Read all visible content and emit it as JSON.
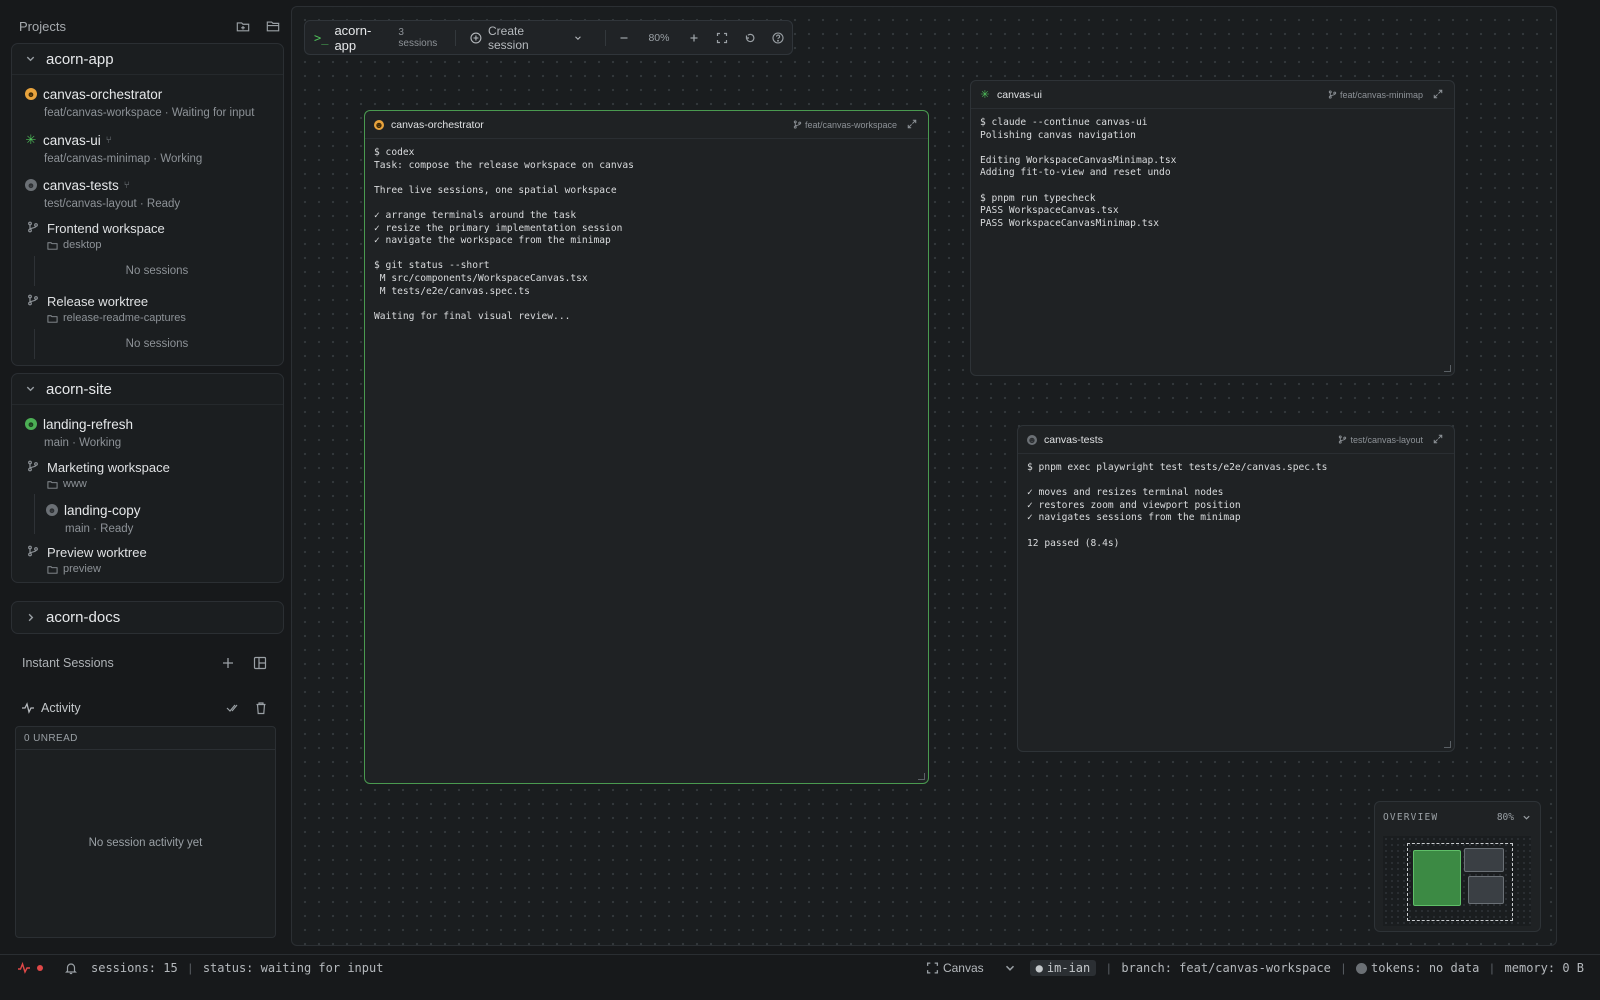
{
  "sidebar": {
    "title": "Projects",
    "projects": [
      {
        "name": "acorn-app",
        "sessions": [
          {
            "name": "canvas-orchestrator",
            "sub": "feat/canvas-workspace · Waiting for input"
          },
          {
            "name": "canvas-ui",
            "sub": "feat/canvas-minimap · Working"
          },
          {
            "name": "canvas-tests",
            "sub": "test/canvas-layout · Ready"
          }
        ],
        "worktrees": [
          {
            "name": "Frontend workspace",
            "folder": "desktop",
            "empty": "No sessions"
          },
          {
            "name": "Release worktree",
            "folder": "release-readme-captures",
            "empty": "No sessions"
          }
        ]
      },
      {
        "name": "acorn-site",
        "sessions": [
          {
            "name": "landing-refresh",
            "sub": "main · Working"
          }
        ],
        "worktrees": [
          {
            "name": "Marketing workspace",
            "folder": "www",
            "session": {
              "name": "landing-copy",
              "sub": "main · Ready"
            }
          },
          {
            "name": "Preview worktree",
            "folder": "preview"
          }
        ]
      },
      {
        "name": "acorn-docs"
      }
    ],
    "instant_sessions": "Instant Sessions",
    "activity": {
      "label": "Activity",
      "unread": "0 UNREAD",
      "empty": "No session activity yet"
    }
  },
  "toolbar": {
    "prompt": ">_",
    "project": "acorn-app",
    "session_count": "3 sessions",
    "create_session": "Create session",
    "zoom": "80%"
  },
  "terminals": [
    {
      "name": "canvas-orchestrator",
      "branch": "feat/canvas-workspace",
      "body": "$ codex\nTask: compose the release workspace on canvas\n\nThree live sessions, one spatial workspace\n\n✓ arrange terminals around the task\n✓ resize the primary implementation session\n✓ navigate the workspace from the minimap\n\n$ git status --short\n M src/components/WorkspaceCanvas.tsx\n M tests/e2e/canvas.spec.ts\n\nWaiting for final visual review..."
    },
    {
      "name": "canvas-ui",
      "branch": "feat/canvas-minimap",
      "body": "$ claude --continue canvas-ui\nPolishing canvas navigation\n\nEditing WorkspaceCanvasMinimap.tsx\nAdding fit-to-view and reset undo\n\n$ pnpm run typecheck\nPASS WorkspaceCanvas.tsx\nPASS WorkspaceCanvasMinimap.tsx"
    },
    {
      "name": "canvas-tests",
      "branch": "test/canvas-layout",
      "body": "$ pnpm exec playwright test tests/e2e/canvas.spec.ts\n\n✓ moves and resizes terminal nodes\n✓ restores zoom and viewport position\n✓ navigates sessions from the minimap\n\n12 passed (8.4s)"
    }
  ],
  "overview": {
    "label": "OVERVIEW",
    "zoom": "80%"
  },
  "statusbar": {
    "sessions": "sessions: 15",
    "status": "status: waiting for input",
    "view": "Canvas",
    "user": "im-ian",
    "branch": "branch: feat/canvas-workspace",
    "tokens": "tokens: no data",
    "memory": "memory: 0 B"
  },
  "colors": {
    "accent_green": "#4caf55",
    "waiting_orange": "#e8a33d",
    "alert_red": "#e04848"
  }
}
